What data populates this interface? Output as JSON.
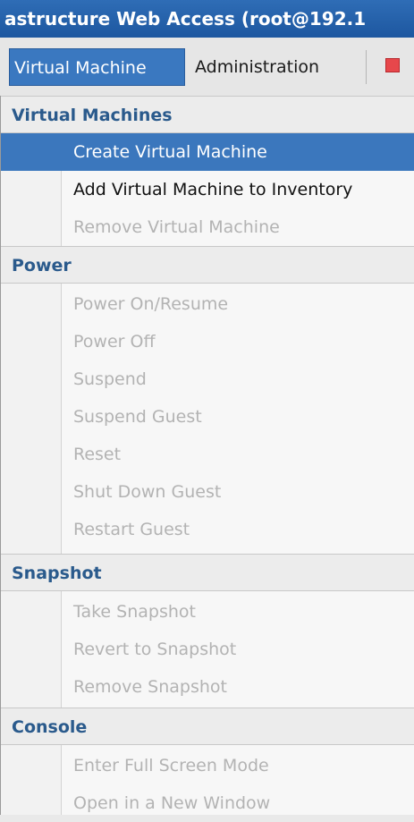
{
  "window": {
    "title": "astructure Web Access (root@192.1"
  },
  "menubar": {
    "tabs": [
      {
        "label": "Virtual Machine",
        "active": true
      },
      {
        "label": "Administration",
        "active": false
      }
    ],
    "stop_icon": "stop-icon"
  },
  "menu": {
    "sections": [
      {
        "label": "Virtual Machines",
        "items": [
          {
            "label": "Create Virtual Machine",
            "enabled": true,
            "selected": true
          },
          {
            "label": "Add Virtual Machine to Inventory",
            "enabled": true,
            "selected": false
          },
          {
            "label": "Remove Virtual Machine",
            "enabled": false,
            "selected": false
          }
        ]
      },
      {
        "label": "Power",
        "items": [
          {
            "label": "Power On/Resume",
            "enabled": false
          },
          {
            "label": "Power Off",
            "enabled": false
          },
          {
            "label": "Suspend",
            "enabled": false
          },
          {
            "label": "Suspend Guest",
            "enabled": false
          },
          {
            "label": "Reset",
            "enabled": false
          },
          {
            "label": "Shut Down Guest",
            "enabled": false
          },
          {
            "label": "Restart Guest",
            "enabled": false
          }
        ]
      },
      {
        "label": "Snapshot",
        "items": [
          {
            "label": "Take Snapshot",
            "enabled": false
          },
          {
            "label": "Revert to Snapshot",
            "enabled": false
          },
          {
            "label": "Remove Snapshot",
            "enabled": false
          }
        ]
      },
      {
        "label": "Console",
        "items": [
          {
            "label": "Enter Full Screen Mode",
            "enabled": false
          },
          {
            "label": "Open in a New Window",
            "enabled": false
          }
        ]
      }
    ]
  },
  "colors": {
    "accent": "#3b77bd",
    "section_text": "#2a5a8c",
    "disabled_text": "#b3b3b3",
    "stop_icon": "#e7474b"
  }
}
